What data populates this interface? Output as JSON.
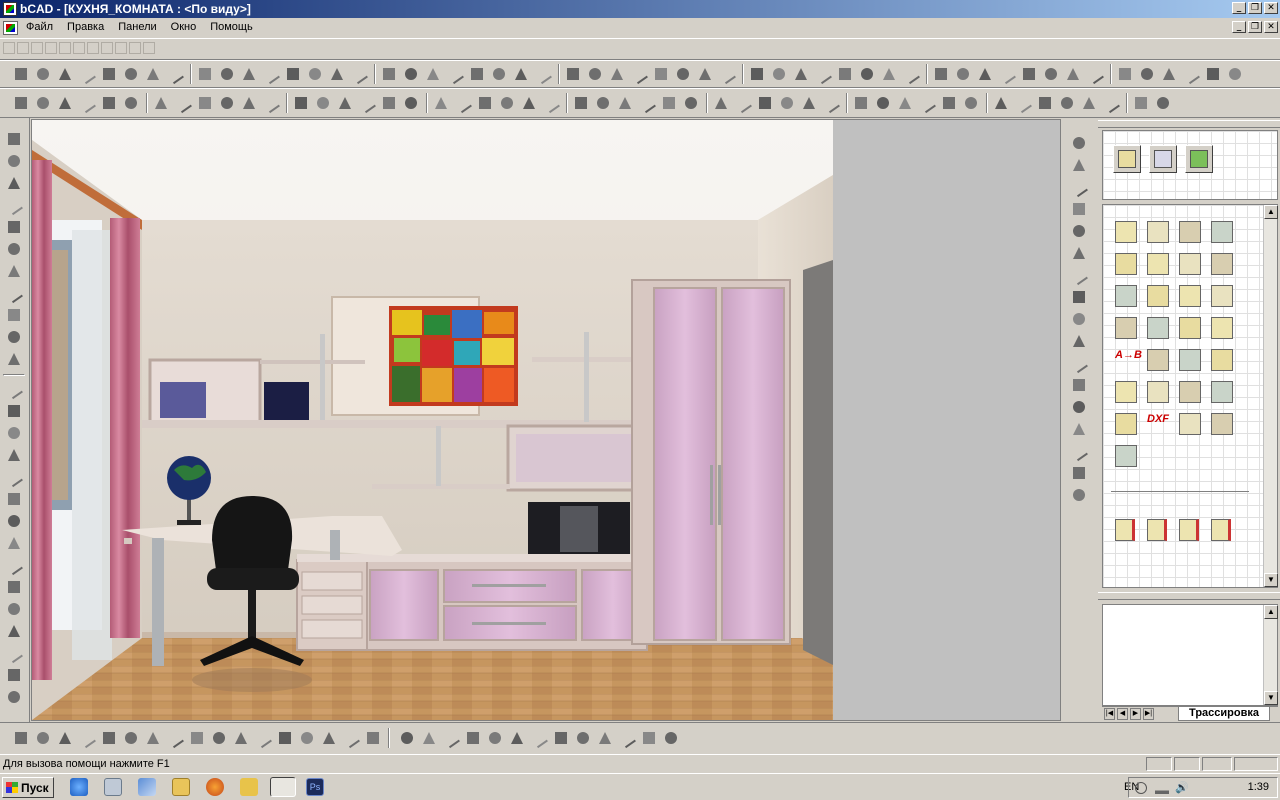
{
  "window": {
    "title": "bCAD - [КУХНЯ_КОМНАТА : <По виду>]"
  },
  "menu": {
    "items": [
      "Файл",
      "Правка",
      "Панели",
      "Окно",
      "Помощь"
    ]
  },
  "panel": {
    "tab_label": "Трассировка"
  },
  "palette_labels": {
    "a_to_b": "A→B",
    "dxf": "DXF"
  },
  "status": {
    "help_text": "Для вызова помощи нажмите F1"
  },
  "taskbar": {
    "start_label": "Пуск",
    "lang": "EN",
    "clock": "1:39"
  },
  "colors": {
    "title_active": "#0a246a",
    "face": "#d4d0c8",
    "wall": "#ddd4c8",
    "floor": "#c89a6a",
    "cabinet_panel": "#d7a9cf",
    "curtain": "#c66884"
  },
  "icons": {
    "toolbar_row_top": [
      "new-doc-icon",
      "open-doc-icon",
      "window-icon",
      "split-icon",
      "fill-icon",
      "text-icon",
      "page-icon",
      "folder-icon",
      "save-icon",
      "print-icon",
      "print-icon",
      "save-icon",
      "cube-icon",
      "pointer-icon",
      "select-icon",
      "node-icon",
      "pen-icon",
      "copy-icon",
      "paste-icon",
      "help-icon",
      "undo-icon",
      "redo-icon",
      "zoom-in-icon",
      "zoom-out-icon",
      "zoom-window-icon",
      "hand-icon",
      "pan-icon",
      "line-icon",
      "arc-icon",
      "layer-icon",
      "render-icon",
      "view-icon"
    ],
    "toolbar_row_second": [
      "snap-icon",
      "snap-icon",
      "mirror-icon",
      "rotate-icon",
      "move-icon",
      "array-icon",
      "grid-icon",
      "cross-icon",
      "snap-point-icon",
      "trim-icon",
      "extend-icon",
      "fillet-icon",
      "chamfer-icon",
      "circle-icon",
      "ellipse-icon",
      "hatch-icon",
      "dimension-icon",
      "measure-icon"
    ],
    "left_toolbar": [
      "line-icon",
      "circle-icon",
      "arc-icon",
      "spline-icon",
      "rectangle-icon",
      "text-icon",
      "hatch-icon",
      "point-icon",
      "polygon-icon",
      "ellipse-icon",
      "dot-icon"
    ],
    "bottom_toolbar": [
      "box-icon",
      "cone-icon",
      "wedge-icon",
      "cylinder-icon",
      "torus-icon",
      "sphere-icon",
      "extrude-icon",
      "revolve-icon"
    ],
    "panel_top": [
      "cabinet-edit-icon",
      "cabinet-draw-icon",
      "palette-icon"
    ],
    "panel_grid": [
      "panel-icon",
      "frame-icon",
      "corner-panel-icon",
      "curved-panel-icon",
      "column-icon",
      "shelf-icon",
      "tools-icon",
      "drawer-icon",
      "cabinet-icon",
      "assembly-icon",
      "label-icon",
      "table-icon",
      "door-icon",
      "price-icon",
      "texture-icon",
      "price-list-icon",
      "a-to-b-icon",
      "hardware-icon",
      "material-icon",
      "cursor-icon",
      "box-icon",
      "delete-icon",
      "hinge-icon",
      "cut-icon",
      "export-icon",
      "dxf-icon",
      "material-box-icon",
      "library-icon",
      "parts-icon"
    ]
  }
}
